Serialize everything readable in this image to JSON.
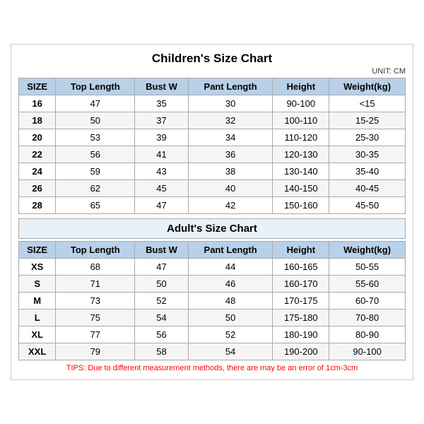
{
  "title": "Children's Size Chart",
  "unit_label": "UNIT: CM",
  "children_section_title": "Children's Size Chart",
  "adult_section_title": "Adult's Size Chart",
  "columns": [
    "SIZE",
    "Top Length",
    "Bust W",
    "Pant Length",
    "Height",
    "Weight(kg)"
  ],
  "children_rows": [
    {
      "size": "16",
      "top_length": "47",
      "bust_w": "35",
      "pant_length": "30",
      "height": "90-100",
      "weight": "<15"
    },
    {
      "size": "18",
      "top_length": "50",
      "bust_w": "37",
      "pant_length": "32",
      "height": "100-110",
      "weight": "15-25"
    },
    {
      "size": "20",
      "top_length": "53",
      "bust_w": "39",
      "pant_length": "34",
      "height": "110-120",
      "weight": "25-30"
    },
    {
      "size": "22",
      "top_length": "56",
      "bust_w": "41",
      "pant_length": "36",
      "height": "120-130",
      "weight": "30-35"
    },
    {
      "size": "24",
      "top_length": "59",
      "bust_w": "43",
      "pant_length": "38",
      "height": "130-140",
      "weight": "35-40"
    },
    {
      "size": "26",
      "top_length": "62",
      "bust_w": "45",
      "pant_length": "40",
      "height": "140-150",
      "weight": "40-45"
    },
    {
      "size": "28",
      "top_length": "65",
      "bust_w": "47",
      "pant_length": "42",
      "height": "150-160",
      "weight": "45-50"
    }
  ],
  "adult_rows": [
    {
      "size": "XS",
      "top_length": "68",
      "bust_w": "47",
      "pant_length": "44",
      "height": "160-165",
      "weight": "50-55"
    },
    {
      "size": "S",
      "top_length": "71",
      "bust_w": "50",
      "pant_length": "46",
      "height": "160-170",
      "weight": "55-60"
    },
    {
      "size": "M",
      "top_length": "73",
      "bust_w": "52",
      "pant_length": "48",
      "height": "170-175",
      "weight": "60-70"
    },
    {
      "size": "L",
      "top_length": "75",
      "bust_w": "54",
      "pant_length": "50",
      "height": "175-180",
      "weight": "70-80"
    },
    {
      "size": "XL",
      "top_length": "77",
      "bust_w": "56",
      "pant_length": "52",
      "height": "180-190",
      "weight": "80-90"
    },
    {
      "size": "XXL",
      "top_length": "79",
      "bust_w": "58",
      "pant_length": "54",
      "height": "190-200",
      "weight": "90-100"
    }
  ],
  "tips": "TIPS: Due to different measurement methods, there are may be an error of 1cm-3cm"
}
